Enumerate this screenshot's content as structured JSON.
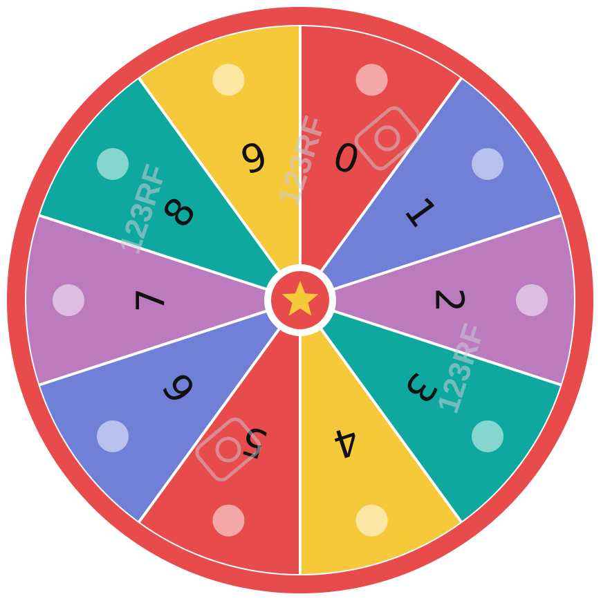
{
  "wheel": {
    "rim_color": "#e84b4b",
    "divider_color": "#ffffff",
    "hub_color": "#e84b4b",
    "hub_ring_color": "#ffffff",
    "star_color": "#f6c93a",
    "hub_icon": "star-icon",
    "segments": [
      {
        "number": "0",
        "color": "#e84b4b",
        "dot_color": "#f4a7a7"
      },
      {
        "number": "1",
        "color": "#6f80d6",
        "dot_color": "#b8c0ee"
      },
      {
        "number": "2",
        "color": "#bb7bbd",
        "dot_color": "#dfbde0"
      },
      {
        "number": "3",
        "color": "#0ea89e",
        "dot_color": "#86d6d0"
      },
      {
        "number": "4",
        "color": "#f6c93a",
        "dot_color": "#fbe6a4"
      },
      {
        "number": "5",
        "color": "#e84b4b",
        "dot_color": "#f4a7a7"
      },
      {
        "number": "6",
        "color": "#6f80d6",
        "dot_color": "#b8c0ee"
      },
      {
        "number": "7",
        "color": "#bb7bbd",
        "dot_color": "#dfbde0"
      },
      {
        "number": "8",
        "color": "#0ea89e",
        "dot_color": "#86d6d0"
      },
      {
        "number": "9",
        "color": "#f6c93a",
        "dot_color": "#fbe6a4"
      }
    ]
  },
  "watermarks": [
    {
      "text": "123RF"
    },
    {
      "text": "123RF"
    },
    {
      "text": "123RF"
    }
  ]
}
